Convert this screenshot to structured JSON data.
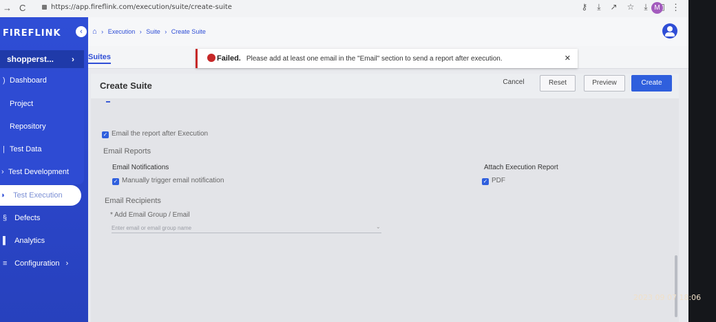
{
  "browser": {
    "url": "https://app.fireflink.com/execution/suite/create-suite",
    "profile_initial": "M"
  },
  "sidebar": {
    "brand": "FIREFLINK",
    "project": "shopperst...",
    "items": [
      {
        "label": "Dashboard",
        "icon": "dashboard-icon"
      },
      {
        "label": "Project",
        "icon": "project-icon"
      },
      {
        "label": "Repository",
        "icon": "repository-icon"
      },
      {
        "label": "Test Data",
        "icon": "test-data-icon"
      },
      {
        "label": "Test Development",
        "icon": "test-development-icon"
      },
      {
        "label": "Test Execution",
        "icon": "test-execution-icon"
      },
      {
        "label": "Defects",
        "icon": "bug-icon"
      },
      {
        "label": "Analytics",
        "icon": "analytics-icon"
      },
      {
        "label": "Configuration",
        "icon": "configuration-icon"
      }
    ]
  },
  "breadcrumb": {
    "items": [
      "Execution",
      "Suite",
      "Create Suite"
    ]
  },
  "tabs": {
    "suites": "Suites"
  },
  "toast": {
    "title": "Failed.",
    "message": "Please add at least one email in the \"Email\" section to send a report after execution."
  },
  "page": {
    "title": "Create Suite",
    "cancel": "Cancel",
    "reset": "Reset",
    "preview": "Preview",
    "create": "Create"
  },
  "form": {
    "email_report_checkbox": "Email the report after Execution",
    "email_reports_heading": "Email Reports",
    "email_notifications_heading": "Email Notifications",
    "manual_trigger": "Manually trigger email notification",
    "attach_heading": "Attach Execution Report",
    "pdf": "PDF",
    "recipients_heading": "Email Recipients",
    "add_group_label": "Add Email Group / Email",
    "required_mark": "*",
    "email_placeholder": "Enter email or email group name"
  },
  "overlay": {
    "timestamp": "2023  09  07 18:06"
  },
  "colors": {
    "accent": "#2f4ed6",
    "error": "#c62828"
  }
}
